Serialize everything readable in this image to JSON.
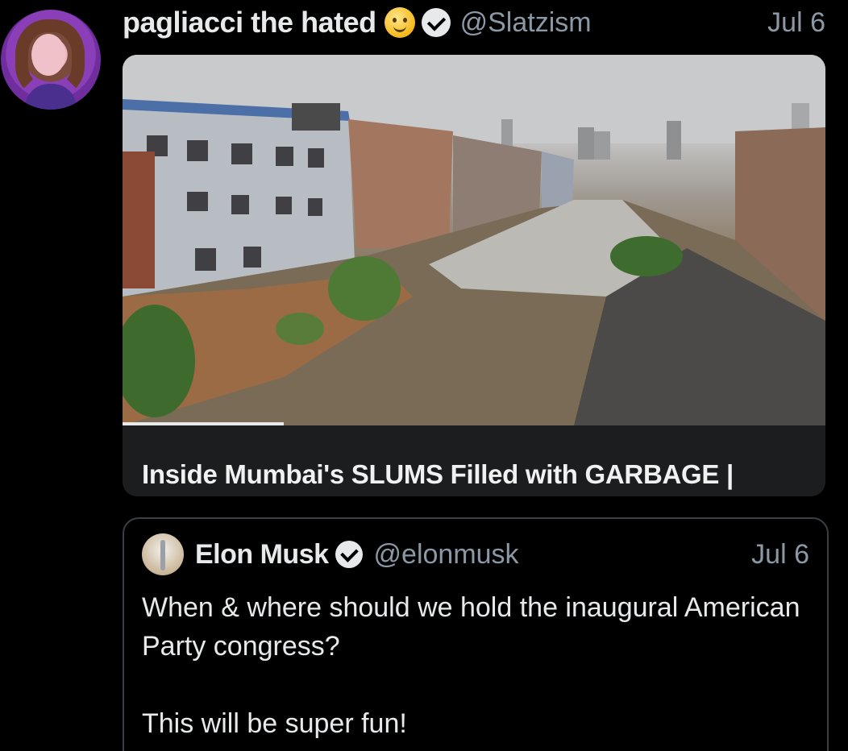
{
  "post": {
    "author_name": "pagliacci the hated",
    "author_handle": "@Slatzism",
    "date": "Jul 6",
    "emoji_icon": "slightly-smiling-face-emoji",
    "media_caption": "Inside Mumbai's SLUMS Filled with GARBAGE |"
  },
  "quoted_post": {
    "author_name": "Elon Musk",
    "author_handle": "@elonmusk",
    "date": "Jul 6",
    "body_line1": "When & where should we hold the inaugural American Party congress?",
    "body_line2": "This will be super fun!"
  }
}
